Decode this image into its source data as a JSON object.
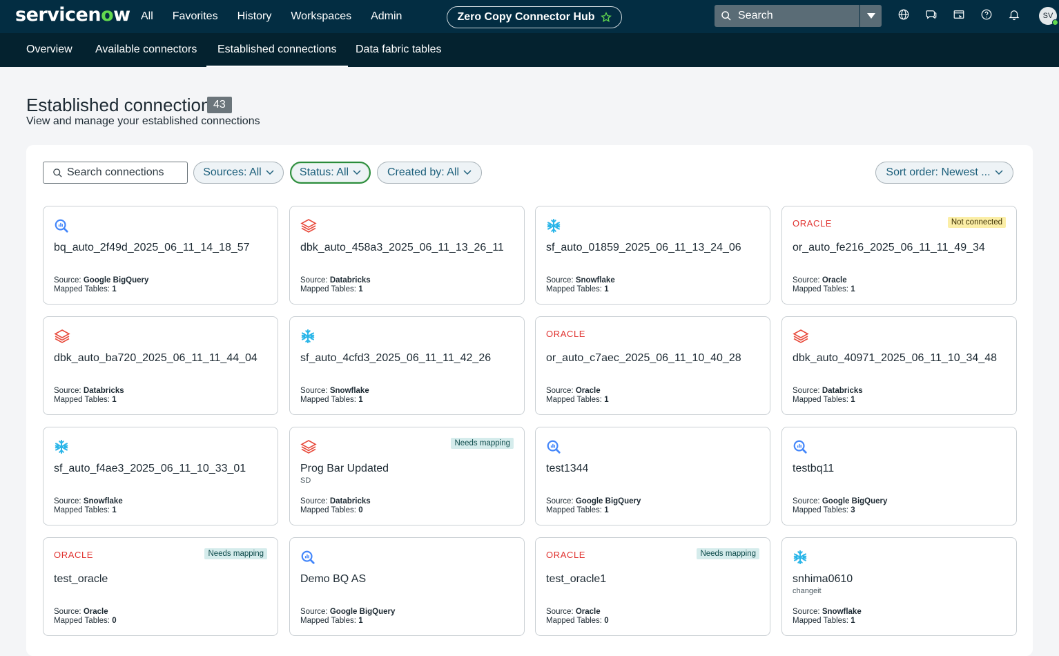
{
  "header": {
    "logo": "servicenow",
    "nav": [
      "All",
      "Favorites",
      "History",
      "Workspaces",
      "Admin"
    ],
    "hub_title": "Zero Copy Connector Hub",
    "search_label": "Search",
    "avatar_initials": "SV"
  },
  "tabs": [
    "Overview",
    "Available connectors",
    "Established connections",
    "Data fabric tables"
  ],
  "active_tab": "Established connections",
  "page": {
    "title": "Established connections",
    "count": "43",
    "subtitle": "View and manage your established connections"
  },
  "filters": {
    "search_placeholder": "Search connections",
    "sources": "Sources: All",
    "status": "Status: All",
    "created_by": "Created by: All",
    "sort": "Sort order: Newest ..."
  },
  "labels": {
    "source": "Source:",
    "mapped": "Mapped Tables:"
  },
  "cards": [
    {
      "name": "bq_auto_2f49d_2025_06_11_14_18_57",
      "source": "Google BigQuery",
      "mapped": "1",
      "icon": "bigquery",
      "badge": "",
      "desc": ""
    },
    {
      "name": "dbk_auto_458a3_2025_06_11_13_26_11",
      "source": "Databricks",
      "mapped": "1",
      "icon": "databricks",
      "badge": "",
      "desc": ""
    },
    {
      "name": "sf_auto_01859_2025_06_11_13_24_06",
      "source": "Snowflake",
      "mapped": "1",
      "icon": "snowflake",
      "badge": "",
      "desc": ""
    },
    {
      "name": "or_auto_fe216_2025_06_11_11_49_34",
      "source": "Oracle",
      "mapped": "1",
      "icon": "oracle",
      "badge": "Not connected",
      "desc": ""
    },
    {
      "name": "dbk_auto_ba720_2025_06_11_11_44_04",
      "source": "Databricks",
      "mapped": "1",
      "icon": "databricks",
      "badge": "",
      "desc": ""
    },
    {
      "name": "sf_auto_4cfd3_2025_06_11_11_42_26",
      "source": "Snowflake",
      "mapped": "1",
      "icon": "snowflake",
      "badge": "",
      "desc": ""
    },
    {
      "name": "or_auto_c7aec_2025_06_11_10_40_28",
      "source": "Oracle",
      "mapped": "1",
      "icon": "oracle",
      "badge": "",
      "desc": ""
    },
    {
      "name": "dbk_auto_40971_2025_06_11_10_34_48",
      "source": "Databricks",
      "mapped": "1",
      "icon": "databricks",
      "badge": "",
      "desc": ""
    },
    {
      "name": "sf_auto_f4ae3_2025_06_11_10_33_01",
      "source": "Snowflake",
      "mapped": "1",
      "icon": "snowflake",
      "badge": "",
      "desc": ""
    },
    {
      "name": "Prog Bar Updated",
      "source": "Databricks",
      "mapped": "0",
      "icon": "databricks",
      "badge": "Needs mapping",
      "desc": "SD"
    },
    {
      "name": "test1344",
      "source": "Google BigQuery",
      "mapped": "1",
      "icon": "bigquery",
      "badge": "",
      "desc": ""
    },
    {
      "name": "testbq11",
      "source": "Google BigQuery",
      "mapped": "3",
      "icon": "bigquery",
      "badge": "",
      "desc": ""
    },
    {
      "name": "test_oracle",
      "source": "Oracle",
      "mapped": "0",
      "icon": "oracle",
      "badge": "Needs mapping",
      "desc": ""
    },
    {
      "name": "Demo BQ AS",
      "source": "Google BigQuery",
      "mapped": "1",
      "icon": "bigquery",
      "badge": "",
      "desc": ""
    },
    {
      "name": "test_oracle1",
      "source": "Oracle",
      "mapped": "0",
      "icon": "oracle",
      "badge": "Needs mapping",
      "desc": ""
    },
    {
      "name": "snhima0610",
      "source": "Snowflake",
      "mapped": "1",
      "icon": "snowflake",
      "badge": "",
      "desc": "changeit"
    }
  ],
  "colors": {
    "topbar": "#032d42",
    "subnav": "#04222f",
    "accent": "#62d84e",
    "oracle": "#e0322f",
    "snowflake": "#29b5e8",
    "bigquery": "#4386fa",
    "databricks": "#e8493a"
  }
}
